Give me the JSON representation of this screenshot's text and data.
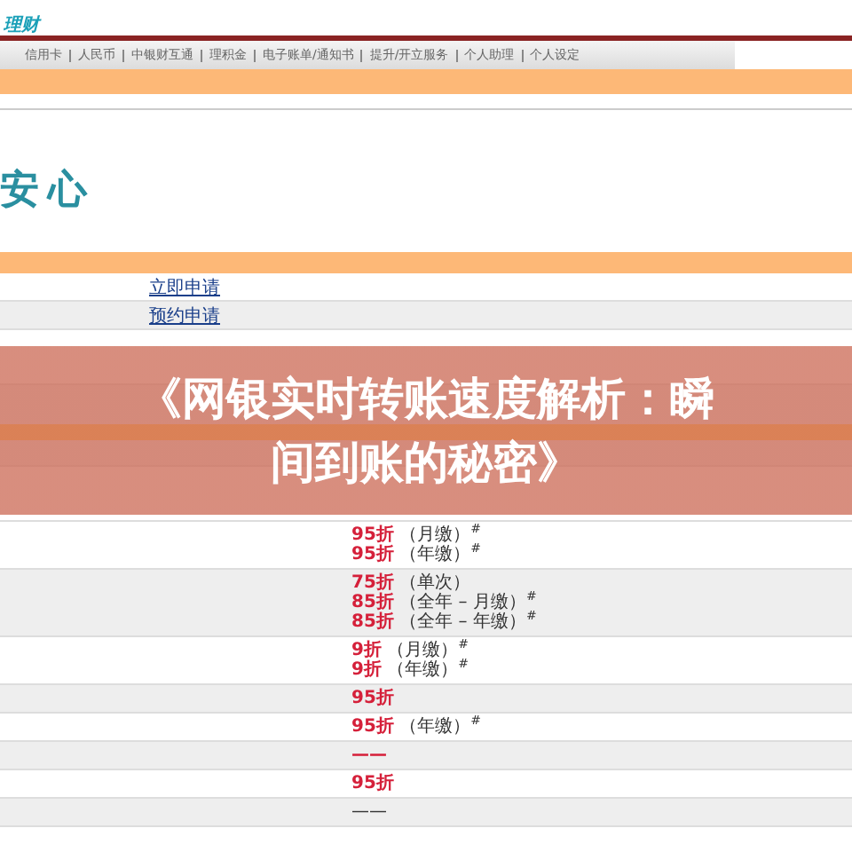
{
  "logo": {
    "lines": [
      "理财"
    ]
  },
  "tabs": [
    {
      "label": "信用卡"
    },
    {
      "label": "人民币"
    },
    {
      "label": "中银财互通"
    },
    {
      "label": "理积金"
    },
    {
      "label": "电子账单/通知书"
    },
    {
      "label": "提升/开立服务"
    },
    {
      "label": "个人助理"
    },
    {
      "label": "个人设定"
    }
  ],
  "heading": "安心",
  "links": [
    "立即申请",
    "预约申请"
  ],
  "table": {
    "rows": [
      {
        "label": "",
        "lines": [
          {
            "kind": "discount",
            "rate": "95折",
            "note": "（月缴）$^{#}$"
          },
          {
            "kind": "discount",
            "rate": "95折",
            "note": "（年缴）$^{#}$"
          }
        ]
      },
      {
        "label": "",
        "lines": [
          {
            "kind": "discount",
            "rate": "75折",
            "note": "（单次）"
          },
          {
            "kind": "discount",
            "rate": "85折",
            "note": "（全年 – 月缴）$^{#}$"
          },
          {
            "kind": "discount",
            "rate": "85折",
            "note": "（全年 – 年缴）$^{#}$"
          }
        ]
      },
      {
        "label": "",
        "lines": [
          {
            "kind": "discount",
            "rate": "9折",
            "note": "（月缴）$^{#}$"
          },
          {
            "kind": "discount",
            "rate": "9折",
            "note": "（年缴）$^{#}$"
          }
        ]
      },
      {
        "label": "",
        "lines": [
          {
            "kind": "discount",
            "rate": "95折"
          }
        ]
      },
      {
        "label": "",
        "lines": [
          {
            "kind": "discount",
            "rate": "95折",
            "note": "（年缴）$^{#}$"
          }
        ]
      },
      {
        "label": "",
        "lines": [
          {
            "kind": "discount",
            "rate": "——"
          }
        ]
      },
      {
        "label": "",
        "lines": [
          {
            "kind": "discount",
            "rate": "95折"
          }
        ]
      },
      {
        "label": "",
        "lines": [
          {
            "kind": "plain",
            "rate": "——"
          }
        ]
      }
    ]
  },
  "banner": {
    "title": "《网银实时转账速度解析：瞬间到账的秘密》"
  }
}
